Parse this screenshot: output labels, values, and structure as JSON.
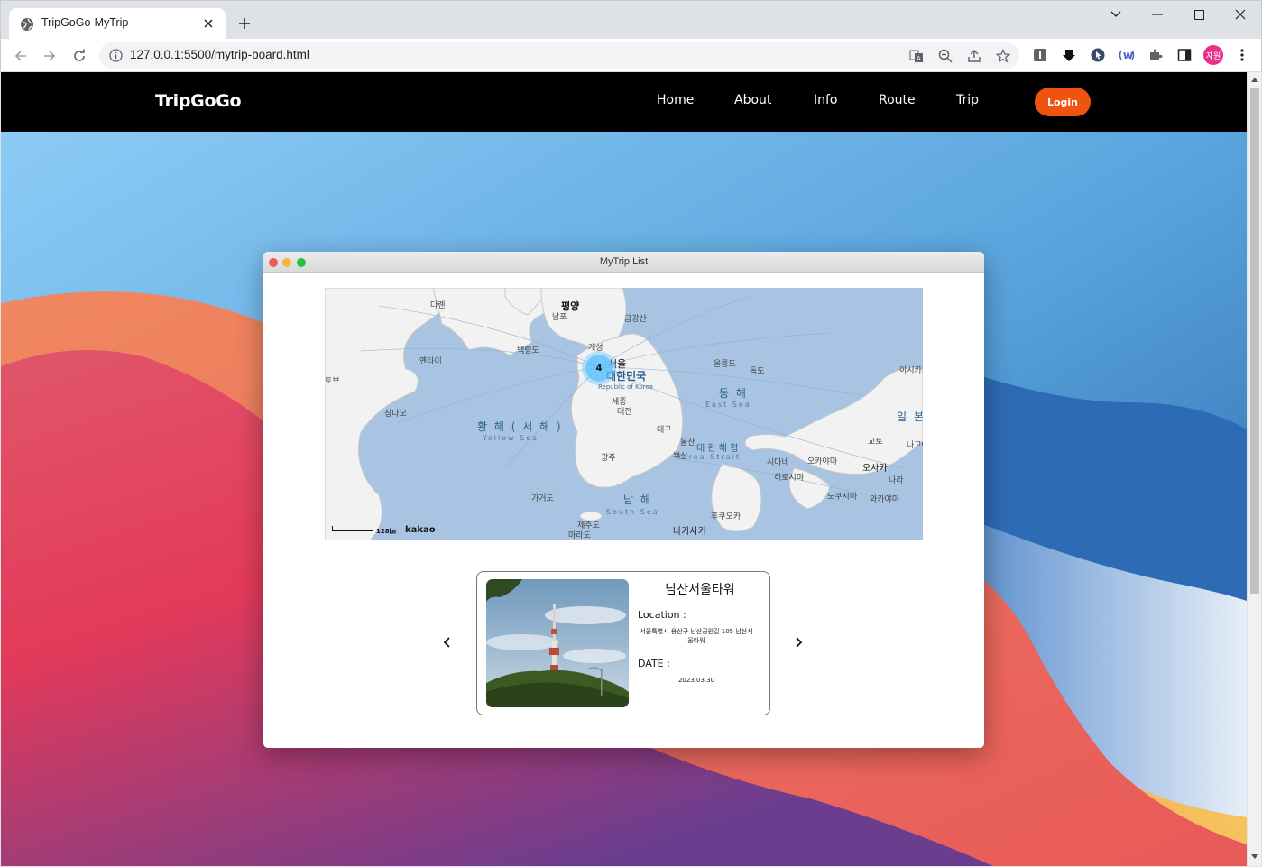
{
  "browser": {
    "tab_title": "TripGoGo-MyTrip",
    "url": "127.0.0.1:5500/mytrip-board.html",
    "profile_label": "지원"
  },
  "site": {
    "logo": "TripGoGo",
    "nav": [
      "Home",
      "About",
      "Info",
      "Route",
      "Trip"
    ],
    "login_label": "Login"
  },
  "window": {
    "title": "MyTrip List"
  },
  "map": {
    "cluster_count": "4",
    "scale_label": "128㎞",
    "attribution": "kakao",
    "labels": {
      "pyongyang": "평양",
      "nampo": "남포",
      "kumgangsan": "금강산",
      "kaesong": "개성",
      "dalian": "다롄",
      "baengnyeongdo": "백령도",
      "yantai": "옌타이",
      "seoul": "서울",
      "korea": "대한민국",
      "korea_en": "Republic of Korea",
      "ulleungdo": "울릉도",
      "dokdo": "독도",
      "sejong": "세종",
      "daejeon": "대전",
      "east_sea": "동 해",
      "east_sea_en": "East Sea",
      "qingdao": "칭다오",
      "yellow_sea": "황 해 ( 서 해 )",
      "yellow_sea_en": "Yellow Sea",
      "daegu": "대구",
      "ulsan": "울산",
      "korea_strait": "대 한 해 협",
      "korea_strait_en": "Korea Strait",
      "busan": "부산",
      "gwangju": "광주",
      "japan": "일 본",
      "kyoto": "교토",
      "osaka": "오사카",
      "okayama": "오카야마",
      "matsue": "시마네",
      "hiroshima": "히로시마",
      "nara": "나라",
      "tokushima": "도쿠시마",
      "wakayama": "와카야마",
      "kagoshima": "가거도",
      "south_sea": "남 해",
      "south_sea_en": "South Sea",
      "jejudo": "제주도",
      "marado": "마라도",
      "fukuoka": "후쿠오카",
      "nagasaki": "나가사키",
      "ishikawa": "이시카와",
      "nagoya": "나고야",
      "left_edge": "토보"
    }
  },
  "card": {
    "title": "남산서울타워",
    "location_label": "Location :",
    "location_value": "서울특별시 용산구 남산공원길 105 남산서울타워",
    "date_label": "DATE :",
    "date_value": "2023.03.30"
  }
}
